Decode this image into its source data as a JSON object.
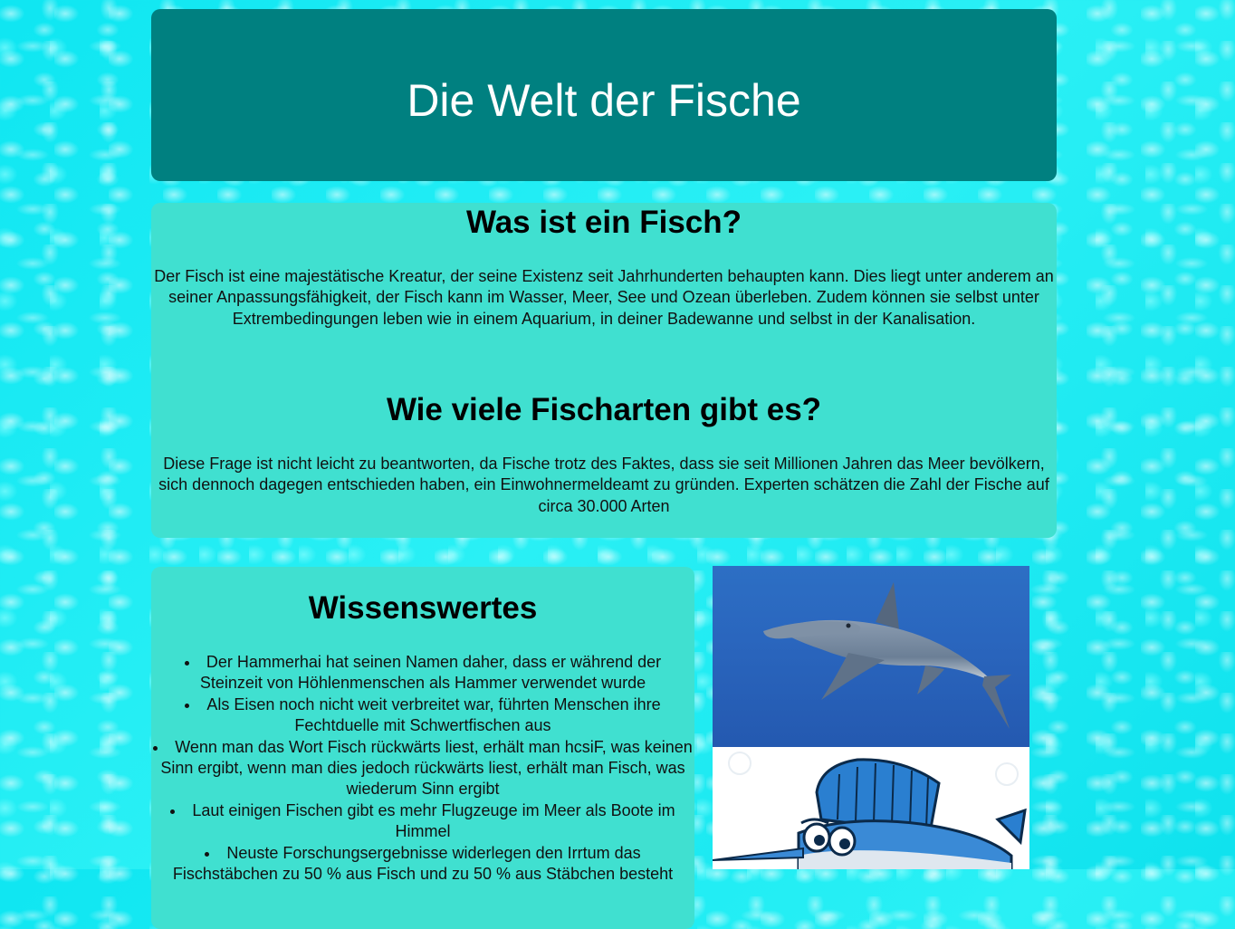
{
  "header": {
    "title": "Die Welt der Fische"
  },
  "info": {
    "section1": {
      "heading": "Was ist ein Fisch?",
      "text": "Der Fisch ist eine majestätische Kreatur, der seine Existenz seit Jahrhunderten behaupten kann. Dies liegt unter anderem an seiner Anpassungsfähigkeit, der Fisch kann im Wasser, Meer, See und Ozean überleben. Zudem können sie selbst unter Extrembedingungen leben wie in einem Aquarium, in deiner Badewanne und selbst in der Kanalisation."
    },
    "section2": {
      "heading": "Wie viele Fischarten gibt es?",
      "text": "Diese Frage ist nicht leicht zu beantworten, da Fische trotz des Faktes, dass sie seit Millionen Jahren das Meer bevölkern, sich dennoch dagegen entschieden haben, ein Einwohnermeldeamt zu gründen. Experten schätzen die Zahl der Fische auf circa 30.000 Arten"
    }
  },
  "facts": {
    "heading": "Wissenswertes",
    "items": [
      "Der Hammerhai hat seinen Namen daher, dass er während der Steinzeit von Höhlenmenschen als Hammer verwendet wurde",
      "Als Eisen noch nicht weit verbreitet war, führten Menschen ihre Fechtduelle mit Schwertfischen aus",
      "Wenn man das Wort Fisch rückwärts liest, erhält man hcsiF, was keinen Sinn ergibt, wenn man dies jedoch rückwärts liest, erhält man Fisch, was wiederum Sinn ergibt",
      "Laut einigen Fischen gibt es mehr Flugzeuge im Meer als Boote im Himmel",
      "Neuste Forschungsergebnisse widerlegen den Irrtum das Fischstäbchen zu 50 % aus Fisch und zu 50 % aus Stäbchen besteht"
    ]
  },
  "images": {
    "photo": "hammerhead-shark-photo",
    "cartoon": "swordfish-cartoon"
  },
  "colors": {
    "header_bg": "#008080",
    "panel_bg": "#40e0d0",
    "page_bg": "#10e8f0"
  }
}
